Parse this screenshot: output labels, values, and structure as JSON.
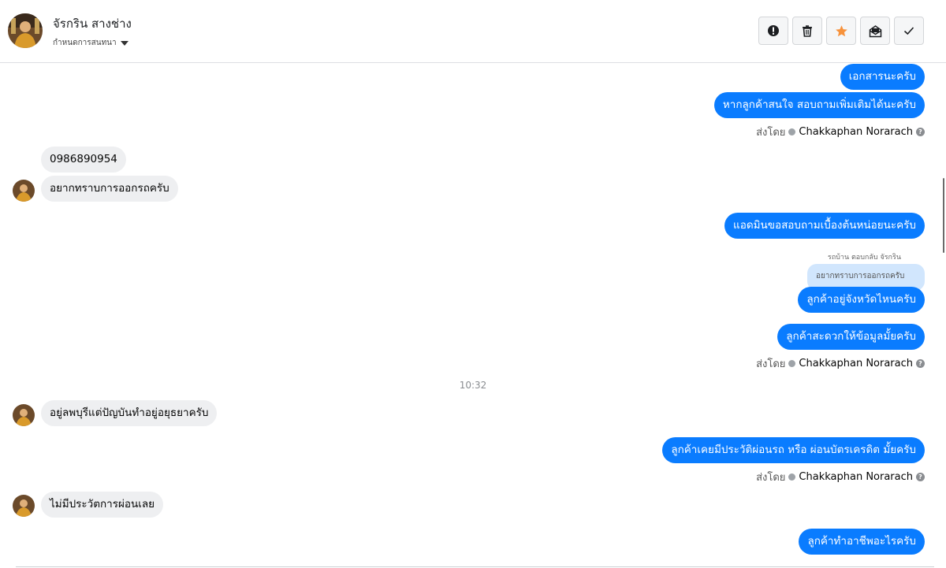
{
  "header": {
    "contact_name": "จัรกริน สางช่าง",
    "conversation_label": "กำหนดการสนทนา",
    "actions": [
      {
        "name": "report-button",
        "icon": "exclamation-icon"
      },
      {
        "name": "delete-button",
        "icon": "trash-icon"
      },
      {
        "name": "star-button",
        "icon": "star-icon"
      },
      {
        "name": "mark-unread-button",
        "icon": "envelope-icon"
      },
      {
        "name": "mark-done-button",
        "icon": "checkmark-icon"
      }
    ]
  },
  "colors": {
    "outgoing_bubble": "#0a7cff",
    "incoming_bubble": "#eeeff1",
    "star": "#f7923b",
    "quote_bubble": "#d1e6fd"
  },
  "messages": {
    "m1": "เอกสารนะครับ",
    "m2": "หากลูกค้าสนใจ สอบถามเพิ่มเติมได้นะครับ",
    "m3": "0986890954",
    "m4": "อยากทราบการออกรถครับ",
    "m5": "แอดมินขอสอบถามเบื้องต้นหน่อยนะครับ",
    "m6": "ลูกค้าอยู่จังหวัดไหนครับ",
    "m7": "ลูกค้าสะดวกให้ข้อมูลมั้ยครับ",
    "m8": "อยู่ลพบุรีแต่ปัญบันทำอยู่อยุธยาครับ",
    "m9": "ลูกค้าเคยมีประวัติผ่อนรถ หรือ ผ่อนบัตรเครดิต มั้ยครับ",
    "m10": "ไม่มีประวัตการผ่อนเลย",
    "m11": "ลูกค้าทำอาชีพอะไรครับ"
  },
  "sent_by": {
    "label": "ส่งโดย",
    "agent": "Chakkaphan Norarach"
  },
  "reply": {
    "note": "รถบ้าน ตอบกลับ จัรกริน",
    "quoted": "อยากทราบการออกรถครับ"
  },
  "timestamp": "10:32"
}
